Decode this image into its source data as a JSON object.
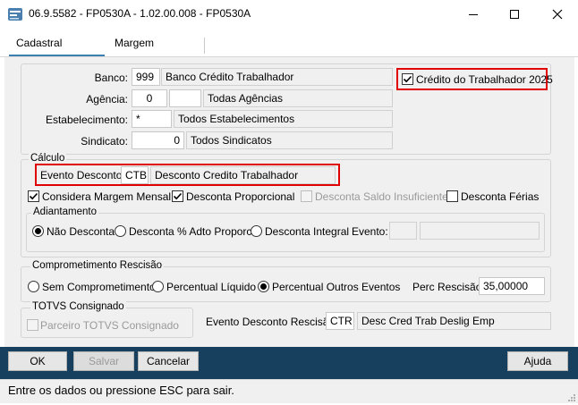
{
  "window": {
    "title": "06.9.5582 - FP0530A - 1.02.00.008 - FP0530A",
    "minimize": "—",
    "maximize": "☐",
    "close": "✕"
  },
  "tabs": [
    {
      "label": "Cadastral",
      "active": true
    },
    {
      "label": "Margem",
      "active": false
    }
  ],
  "header": {
    "banco": {
      "label": "Banco:",
      "code": "999",
      "name": "Banco Crédito Trabalhador"
    },
    "agencia": {
      "label": "Agência:",
      "code": "0",
      "code2": "",
      "name": "Todas Agências"
    },
    "estabelecimento": {
      "label": "Estabelecimento:",
      "code": "*",
      "name": "Todos Estabelecimentos"
    },
    "sindicato": {
      "label": "Sindicato:",
      "code": "0",
      "name": "Todos Sindicatos"
    },
    "credito_trabalhador": {
      "label": "Crédito do Trabalhador 2025",
      "checked": true
    }
  },
  "calculo": {
    "legend": "Cálculo",
    "evento_desconto": {
      "label": "Evento Desconto:",
      "code": "CTB",
      "name": "Desconto Credito Trabalhador"
    },
    "checks": [
      {
        "label": "Considera Margem Mensal",
        "checked": true,
        "disabled": false
      },
      {
        "label": "Desconta Proporcional",
        "checked": true,
        "disabled": false
      },
      {
        "label": "Desconta Saldo Insuficiente",
        "checked": false,
        "disabled": true
      },
      {
        "label": "Desconta Férias",
        "checked": false,
        "disabled": false
      }
    ],
    "adiantamento": {
      "legend": "Adiantamento",
      "options": [
        {
          "label": "Não Desconta",
          "selected": true
        },
        {
          "label": "Desconta % Adto Proporc",
          "selected": false
        },
        {
          "label": "Desconta Integral",
          "selected": false
        }
      ],
      "evento_label": "Evento:",
      "evento_code": "",
      "evento_name": ""
    }
  },
  "rescisao": {
    "legend": "Comprometimento Rescisão",
    "options": [
      {
        "label": "Sem Comprometimento",
        "selected": false
      },
      {
        "label": "Percentual Líquido",
        "selected": false
      },
      {
        "label": "Percentual Outros Eventos",
        "selected": true
      }
    ],
    "perc_label": "Perc Rescisão:",
    "perc_value": "35,00000"
  },
  "totvs": {
    "legend": "TOTVS Consignado",
    "parceiro_label": "Parceiro TOTVS Consignado",
    "parceiro_checked": false
  },
  "evento_rescisao": {
    "label": "Evento Desconto Rescisão:",
    "code": "CTR",
    "name": "Desc Cred Trab Deslig Emp"
  },
  "buttons": {
    "ok": "OK",
    "salvar": "Salvar",
    "cancelar": "Cancelar",
    "ajuda": "Ajuda"
  },
  "status": {
    "text": "Entre os dados ou pressione ESC para sair."
  },
  "colors": {
    "toolbar": "#17405f",
    "highlight": "#e00000",
    "tab_underline": "#3c7fb1"
  }
}
